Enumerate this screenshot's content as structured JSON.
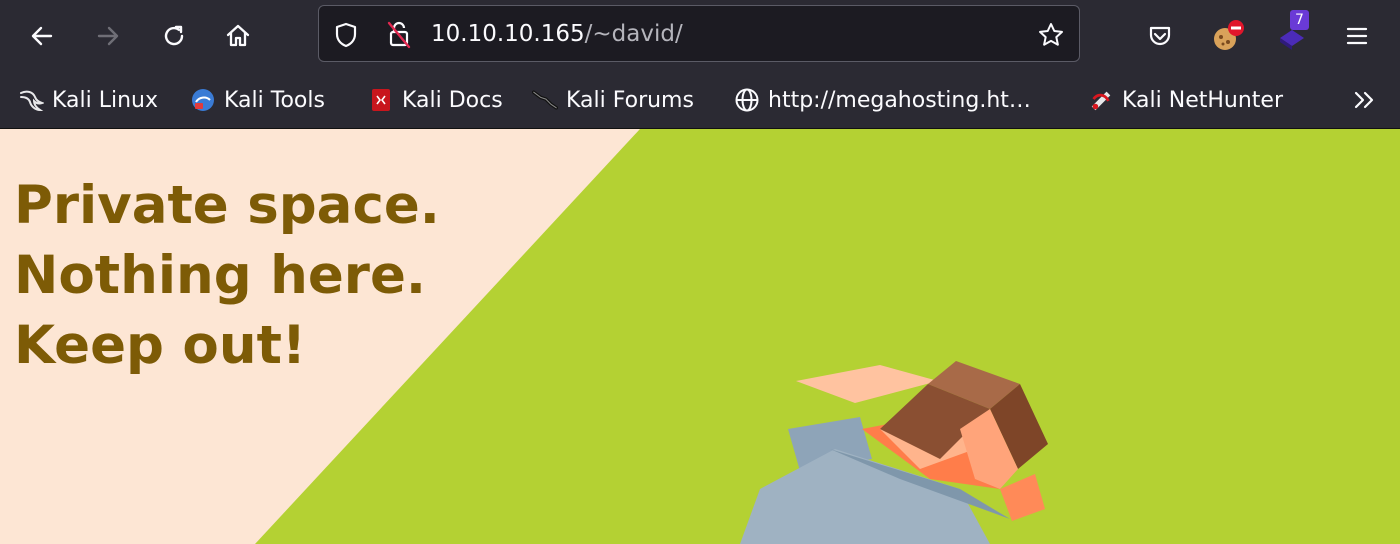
{
  "browser": {
    "url_host": "10.10.10.165",
    "url_path": "/~david/",
    "extension_badge": "7",
    "bookmarks": [
      {
        "label": "Kali Linux"
      },
      {
        "label": "Kali Tools"
      },
      {
        "label": "Kali Docs"
      },
      {
        "label": "Kali Forums"
      },
      {
        "label": "http://megahosting.ht…"
      },
      {
        "label": "Kali NetHunter"
      }
    ]
  },
  "page": {
    "lines": [
      "Private space.",
      "Nothing here.",
      "Keep out!"
    ]
  },
  "colors": {
    "toolbar": "#2b2a33",
    "grass": "#b4d133",
    "sand": "#fde6d4",
    "heading": "#7d5b06"
  }
}
